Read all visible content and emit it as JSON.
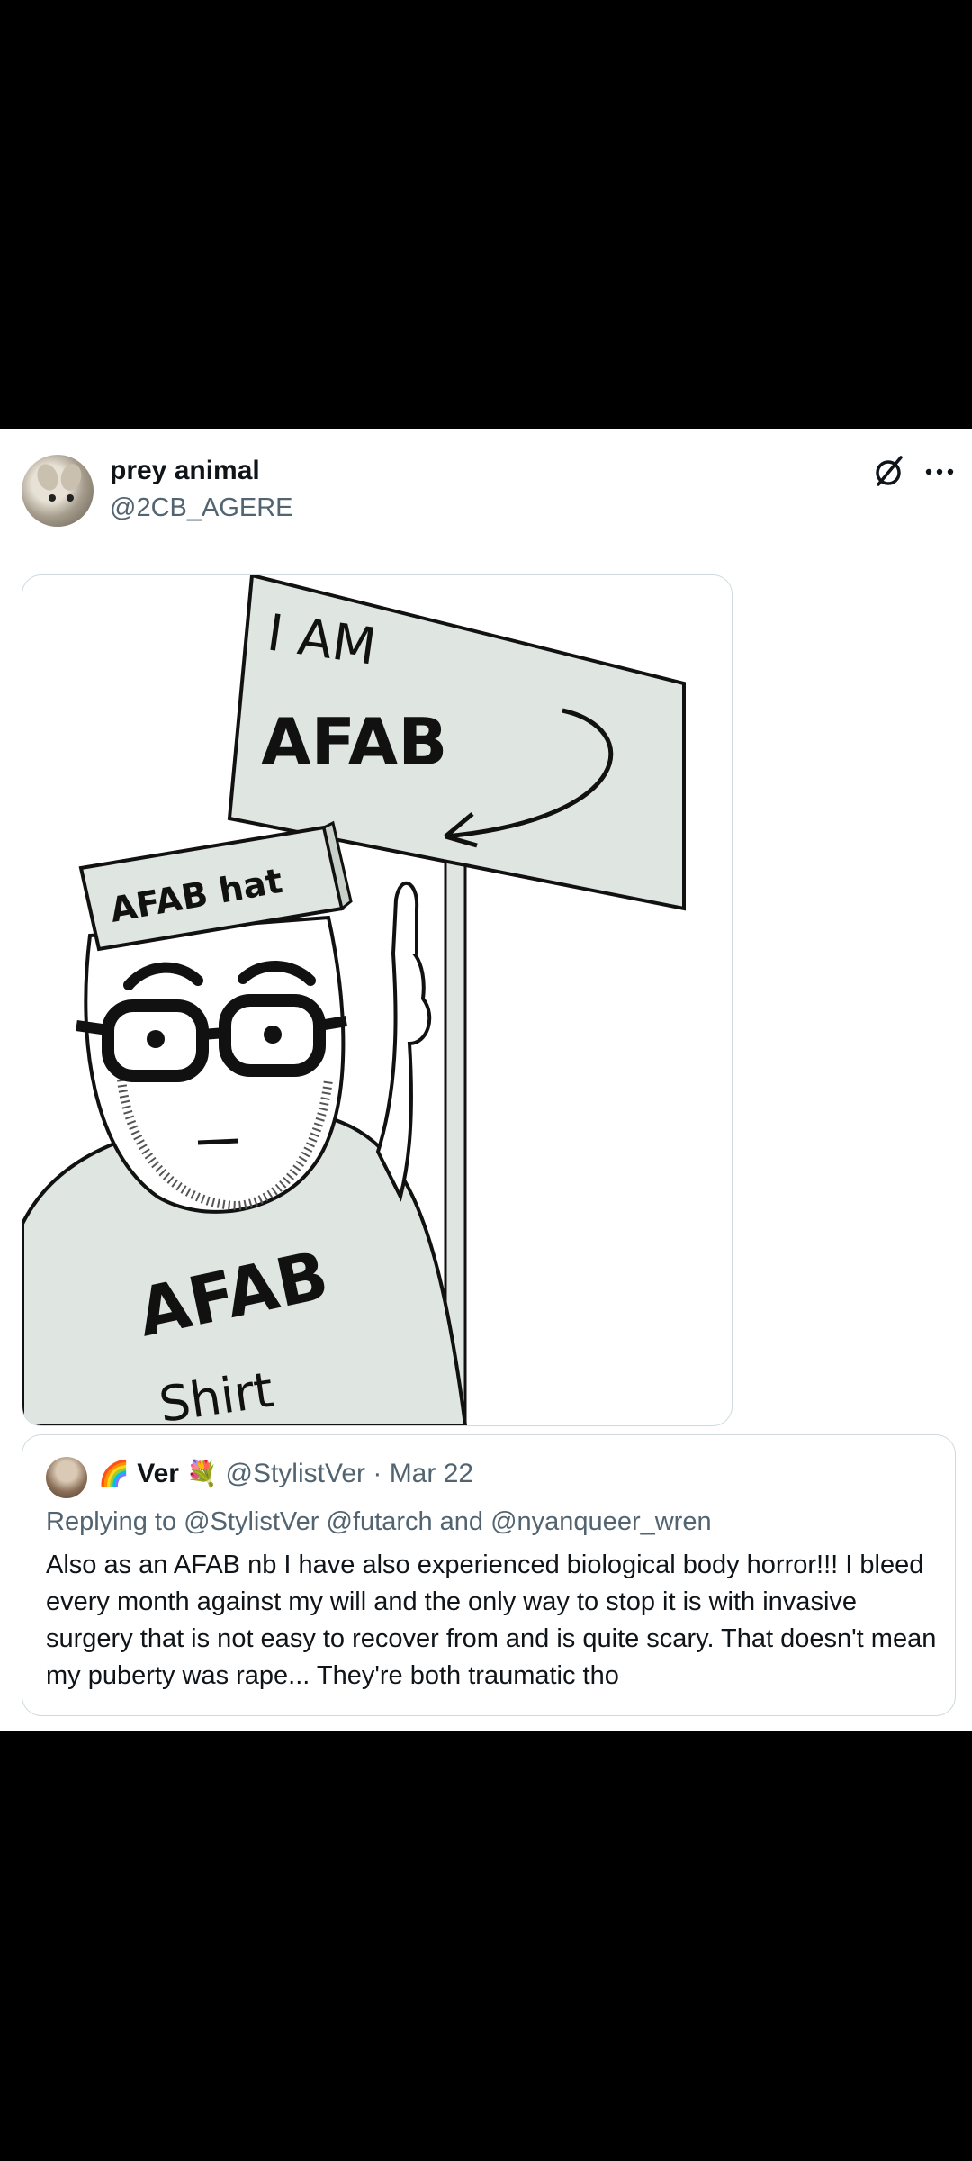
{
  "tweet": {
    "display_name": "prey animal",
    "handle": "@2CB_AGERE",
    "grok_icon": "grok-icon",
    "more_icon": "more-icon"
  },
  "media": {
    "sign_line1": "I AM",
    "sign_line2": "AFAB",
    "hat_text": "AFAB hat",
    "shirt_line1": "AFAB",
    "shirt_line2": "Shirt"
  },
  "quote": {
    "emoji_before": "🌈",
    "name": "Ver",
    "emoji_after": "💐",
    "handle": "@StylistVer",
    "separator": "·",
    "date": "Mar 22",
    "replying_to": "Replying to @StylistVer @futarch and @nyanqueer_wren",
    "text": "Also as an AFAB nb I have also experienced biological body horror!!! I bleed every month against my will and the only way to stop it is with invasive surgery that is not easy to recover from and is quite scary. That doesn't mean my puberty was rape... They're both traumatic tho"
  }
}
